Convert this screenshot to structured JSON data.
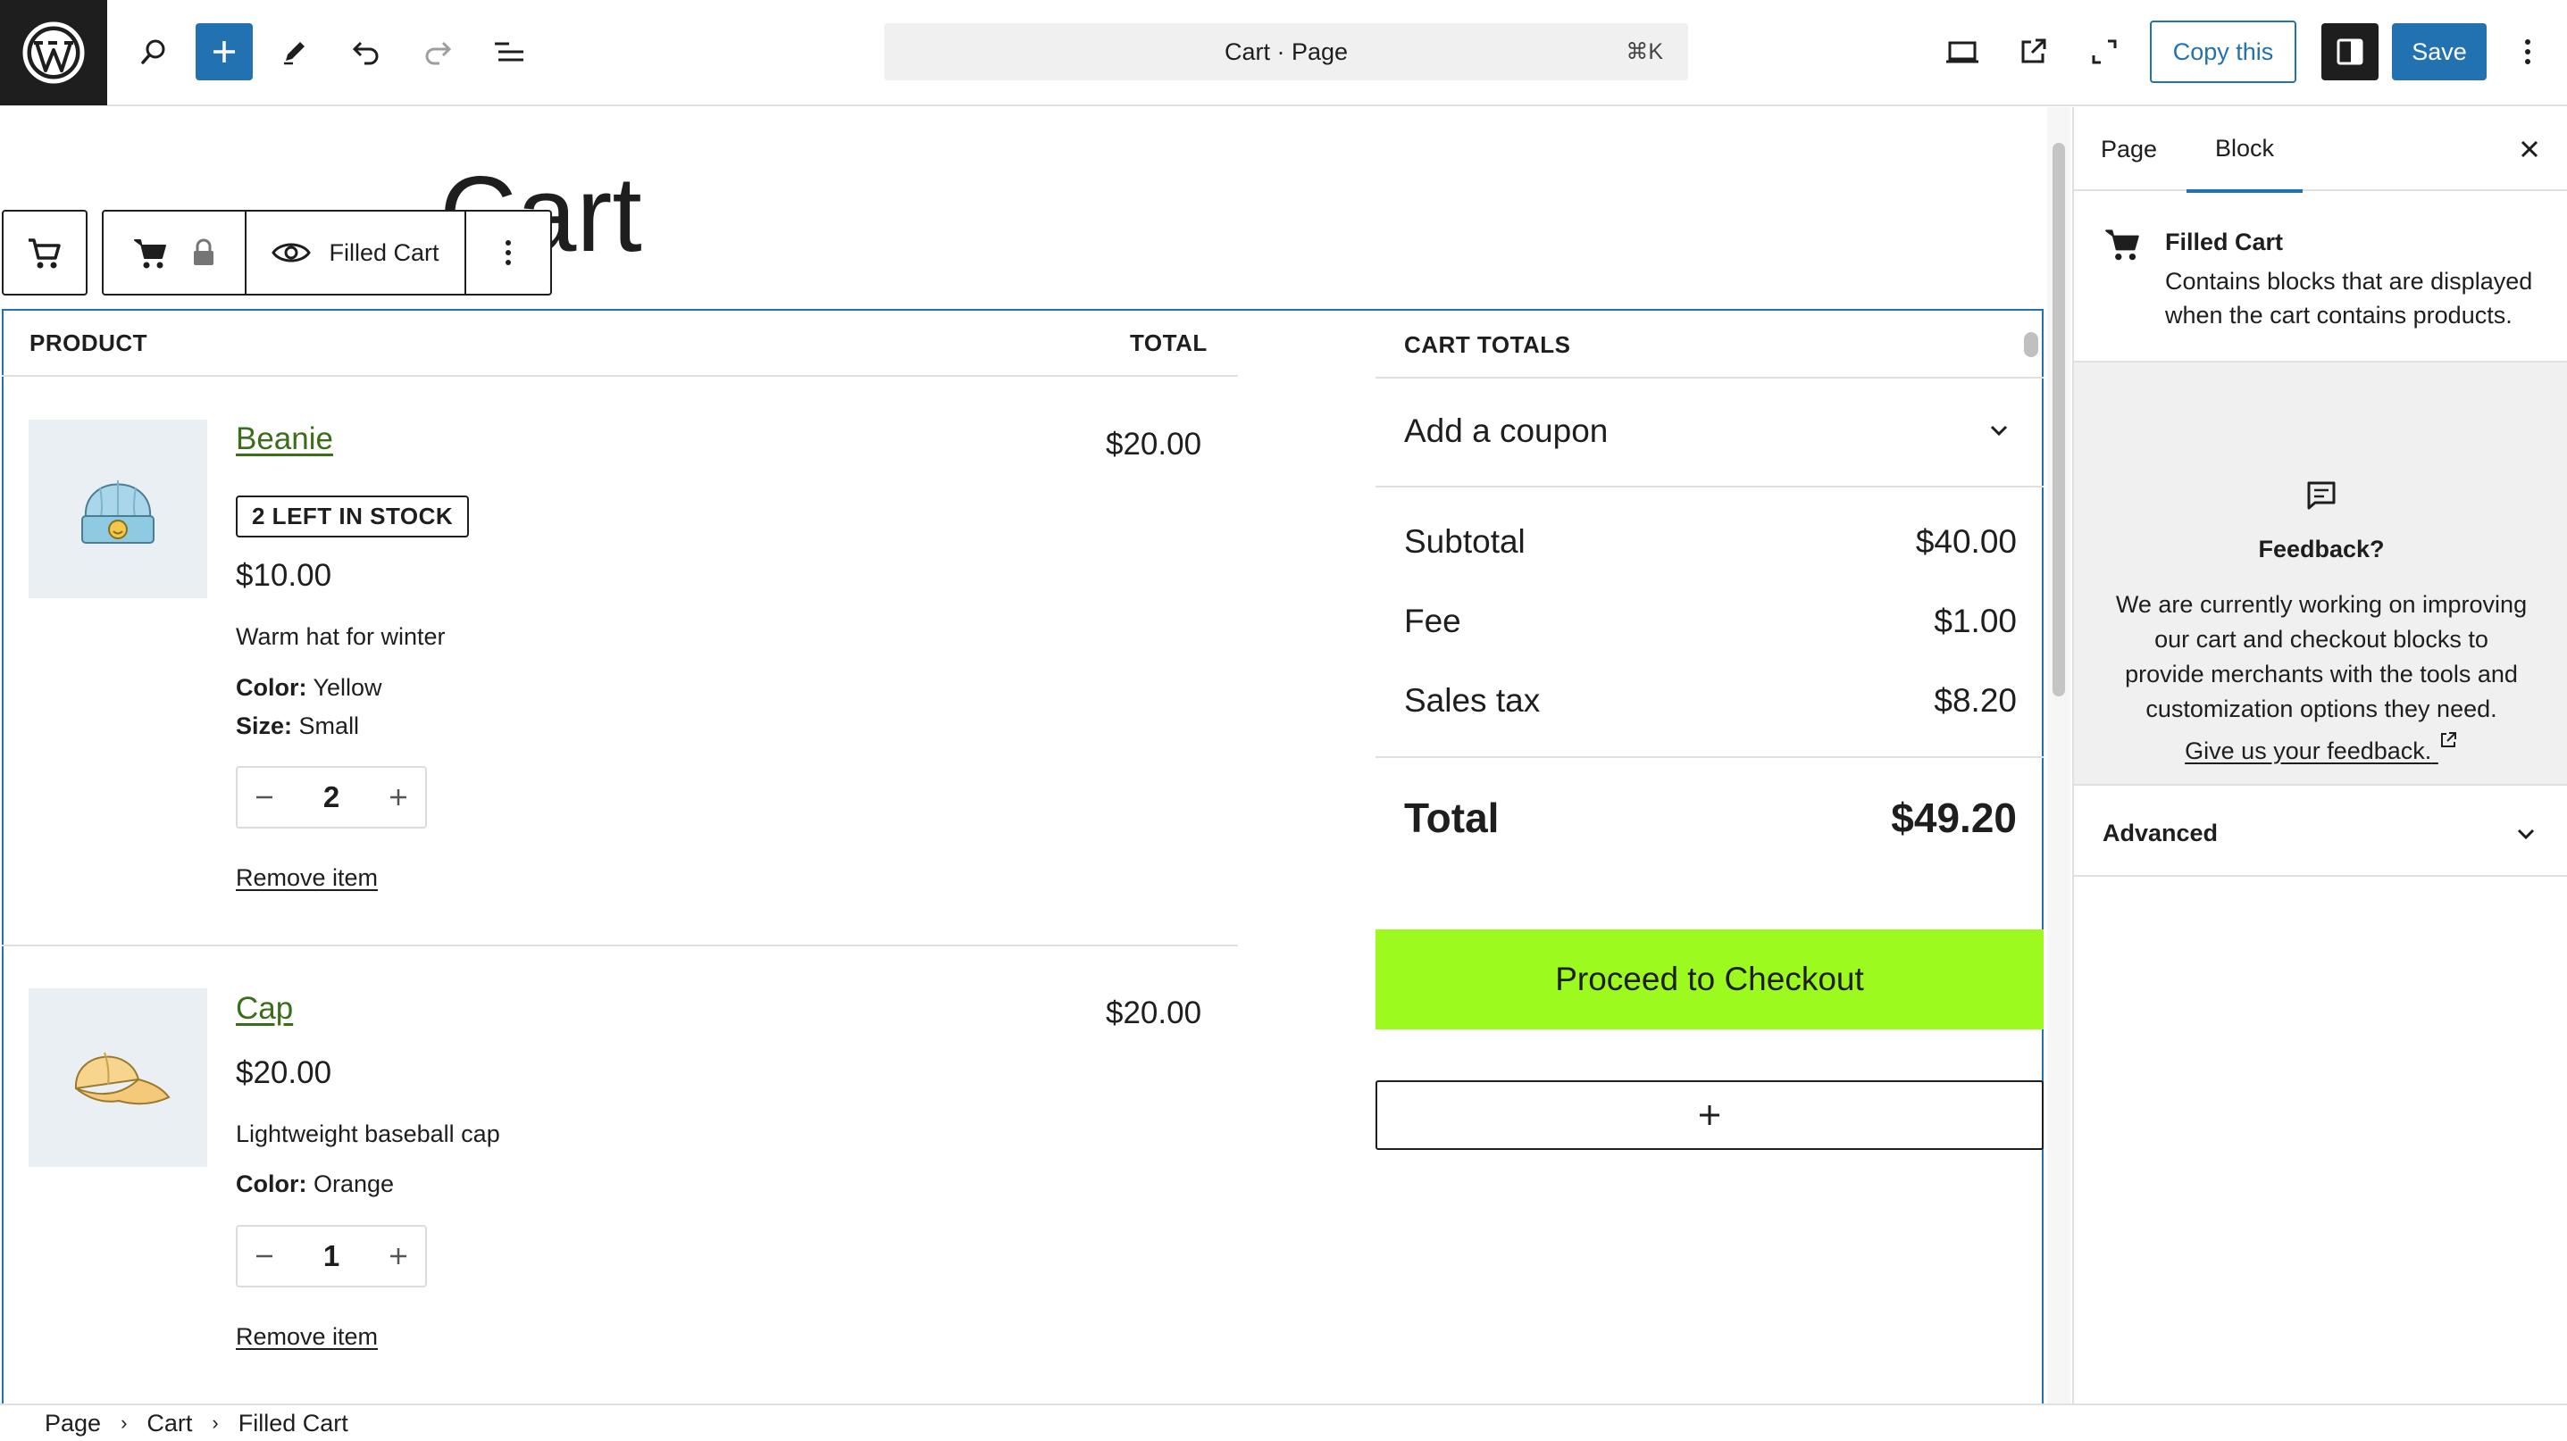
{
  "topbar": {
    "document_title": "Cart · Page",
    "shortcut": "⌘K",
    "copy_label": "Copy this",
    "save_label": "Save"
  },
  "page": {
    "title": "Cart"
  },
  "block_toolbar": {
    "label": "Filled Cart"
  },
  "cart": {
    "product_header": "PRODUCT",
    "total_header": "TOTAL",
    "items": [
      {
        "name": "Beanie",
        "stock_badge": "2 LEFT IN STOCK",
        "price": "$10.00",
        "description": "Warm hat for winter",
        "attributes": [
          {
            "key": "Color:",
            "value": "Yellow"
          },
          {
            "key": "Size:",
            "value": "Small"
          }
        ],
        "quantity": "2",
        "line_total": "$20.00",
        "remove_label": "Remove item"
      },
      {
        "name": "Cap",
        "price": "$20.00",
        "description": "Lightweight baseball cap",
        "attributes": [
          {
            "key": "Color:",
            "value": "Orange"
          }
        ],
        "quantity": "1",
        "line_total": "$20.00",
        "remove_label": "Remove item"
      }
    ]
  },
  "totals": {
    "header": "CART TOTALS",
    "coupon_label": "Add a coupon",
    "subtotal_label": "Subtotal",
    "subtotal_value": "$40.00",
    "fee_label": "Fee",
    "fee_value": "$1.00",
    "tax_label": "Sales tax",
    "tax_value": "$8.20",
    "total_label": "Total",
    "total_value": "$49.20",
    "checkout_label": "Proceed to Checkout",
    "checkout_color": "#9dfa1e"
  },
  "breadcrumb": [
    "Page",
    "Cart",
    "Filled Cart"
  ],
  "sidebar": {
    "tabs": [
      "Page",
      "Block"
    ],
    "active_tab": "Block",
    "block_title": "Filled Cart",
    "block_description": "Contains blocks that are displayed when the cart contains products.",
    "feedback_title": "Feedback?",
    "feedback_text": "We are currently working on improving our cart and checkout blocks to provide merchants with the tools and customization options they need.",
    "feedback_link": "Give us your feedback.",
    "advanced_label": "Advanced"
  },
  "colors": {
    "accent": "#2271b1",
    "product_link": "#3a6e1b",
    "dark": "#1e1e1e"
  }
}
